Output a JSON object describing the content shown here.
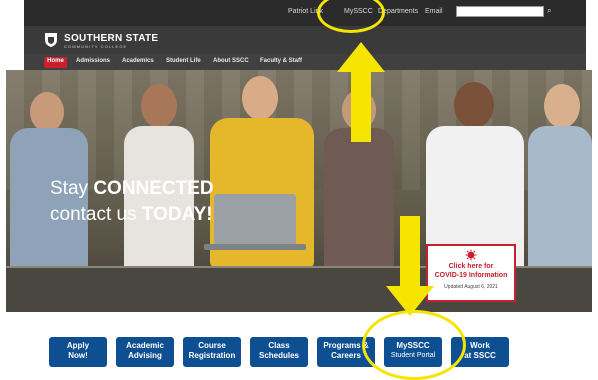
{
  "utility_nav": {
    "links": [
      "Patriot Link",
      "MySSCC",
      "Departments",
      "Email"
    ],
    "search_placeholder": ""
  },
  "branding": {
    "name_line1": "SOUTHERN STATE",
    "name_line2": "COMMUNITY COLLEGE"
  },
  "main_nav": {
    "items": [
      "Home",
      "Admissions",
      "Academics",
      "Student Life",
      "About SSCC",
      "Faculty & Staff"
    ]
  },
  "hero": {
    "headline_line1_prefix": "Stay ",
    "headline_line1_bold": "CONNECTED",
    "headline_line2_prefix": "contact us ",
    "headline_line2_bold": "TODAY!"
  },
  "covid_notice": {
    "line1": "Click here for",
    "line2": "COVID-19 Information",
    "line3": "Updated August 6, 2021"
  },
  "quick_links": [
    {
      "line1": "Apply",
      "line2": "Now!"
    },
    {
      "line1": "Academic",
      "line2": "Advising"
    },
    {
      "line1": "Course",
      "line2": "Registration"
    },
    {
      "line1": "Class",
      "line2": "Schedules"
    },
    {
      "line1": "Programs &",
      "line2": "Careers"
    },
    {
      "line1": "MySSCC",
      "line2": "Student Portal"
    },
    {
      "line1": "Work",
      "line2": "at SSCC"
    }
  ],
  "colors": {
    "brand_red": "#c8202f",
    "button_blue": "#0e4f92",
    "annotation_yellow": "#f6e500"
  }
}
